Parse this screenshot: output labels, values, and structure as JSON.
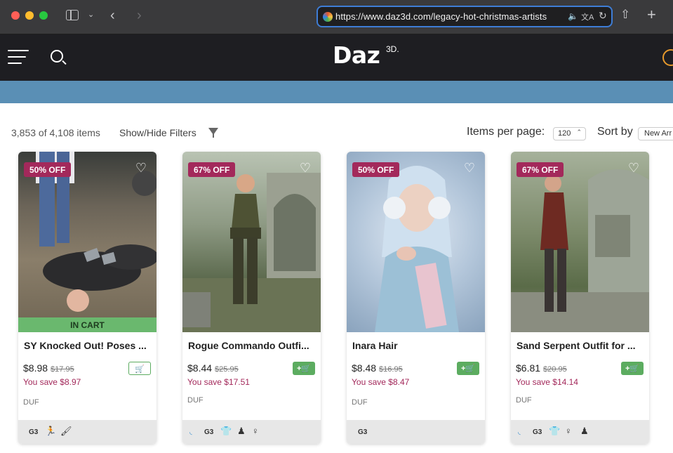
{
  "browser": {
    "url": "https://www.daz3d.com/legacy-hot-christmas-artists"
  },
  "site": {
    "logo": "Daz",
    "logo_sup": "3D."
  },
  "toolbar": {
    "items_count": "3,853 of 4,108 items",
    "show_filters": "Show/Hide Filters",
    "items_per_page_label": "Items per page:",
    "items_per_page_value": "120",
    "sort_label": "Sort by",
    "sort_value": "New Arr"
  },
  "products": [
    {
      "discount": "50% OFF",
      "in_cart": "IN CART",
      "title": "SY Knocked Out! Poses ...",
      "price": "$8.98",
      "old_price": "$17.95",
      "save": "You save $8.97",
      "format": "DUF",
      "tags": [
        "G3"
      ]
    },
    {
      "discount": "67% OFF",
      "title": "Rogue Commando Outfi...",
      "price": "$8.44",
      "old_price": "$25.95",
      "save": "You save $17.51",
      "format": "DUF",
      "tags": [
        "G3"
      ]
    },
    {
      "discount": "50% OFF",
      "title": "Inara Hair",
      "price": "$8.48",
      "old_price": "$16.95",
      "save": "You save $8.47",
      "format": "DUF",
      "tags": [
        "G3"
      ]
    },
    {
      "discount": "67% OFF",
      "title": "Sand Serpent Outfit for ...",
      "price": "$6.81",
      "old_price": "$20.95",
      "save": "You save $14.14",
      "format": "DUF",
      "tags": [
        "G3"
      ]
    }
  ],
  "colors": {
    "discount_badge": "#a3295b",
    "cart_green": "#5cac60",
    "header_bg": "#1e1e22",
    "promo_strip": "#5a8fb5"
  }
}
